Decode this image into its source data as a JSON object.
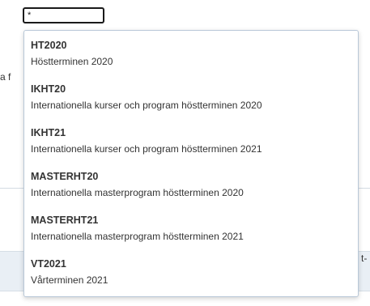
{
  "search": {
    "value": "*",
    "placeholder": ""
  },
  "background": {
    "left_fragment": "a f",
    "right_fragment": "t-"
  },
  "dropdown": {
    "options": [
      {
        "code": "HT2020",
        "description": "Höstterminen 2020"
      },
      {
        "code": "IKHT20",
        "description": "Internationella kurser och program höstterminen 2020"
      },
      {
        "code": "IKHT21",
        "description": "Internationella kurser och program höstterminen 2021"
      },
      {
        "code": "MASTERHT20",
        "description": "Internationella masterprogram höstterminen 2020"
      },
      {
        "code": "MASTERHT21",
        "description": "Internationella masterprogram höstterminen 2021"
      },
      {
        "code": "VT2021",
        "description": "Vårterminen 2021"
      }
    ]
  },
  "colors": {
    "text": "#333333",
    "dropdown_border": "#b9c8d8",
    "input_border": "#1a1a1a"
  }
}
